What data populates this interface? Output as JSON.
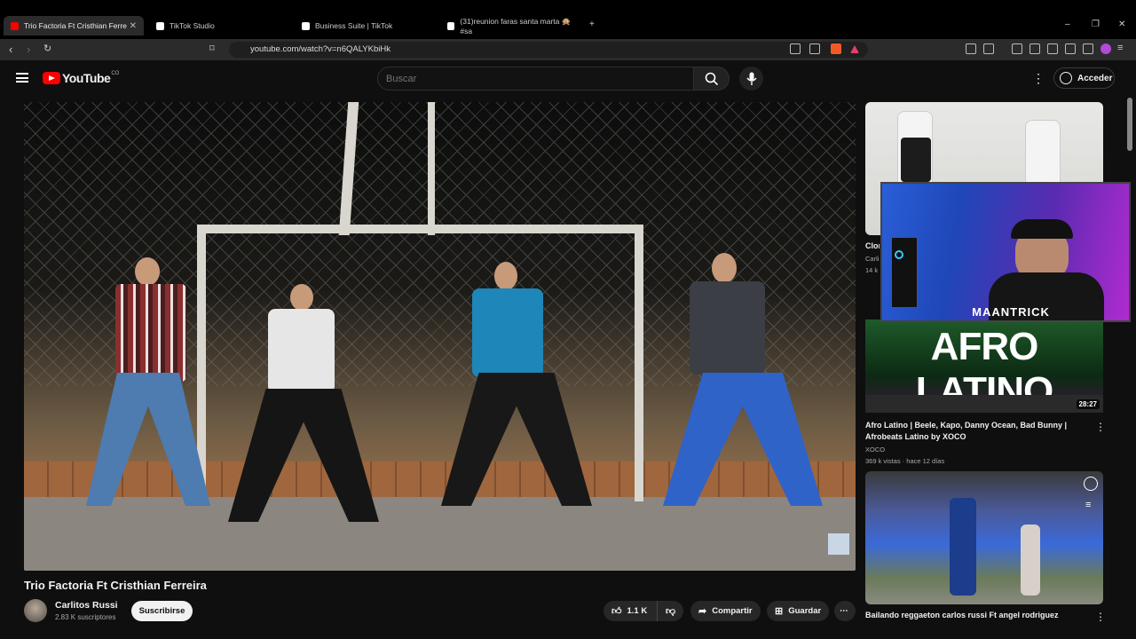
{
  "browser": {
    "tabs": [
      {
        "label": "Trio Factoria Ft Cristhian Ferre"
      },
      {
        "label": "TikTok Studio"
      },
      {
        "label": "Business Suite | TikTok"
      },
      {
        "label": "(31)reunion faras santa marta 🙊#sa"
      }
    ],
    "url": "youtube.com/watch?v=n6QALYKbiHk"
  },
  "youtube": {
    "logo_text": "YouTube",
    "logo_country": "CO",
    "search_placeholder": "Buscar",
    "signin_label": "Acceder"
  },
  "video": {
    "title": "Trio Factoria Ft Cristhian Ferreira",
    "channel": "Carlitos Russi",
    "subscribers": "2.83 K suscriptores",
    "subscribe_label": "Suscribirse",
    "likes": "1.1 K",
    "share_label": "Compartir",
    "save_label": "Guardar"
  },
  "sidebar": {
    "items": [
      {
        "title": "Clon",
        "channel": "Carli",
        "meta": "14 k"
      },
      {
        "thumb_text": "AFRO LATINO",
        "duration": "28:27",
        "title": "Afro Latino | Beele, Kapo, Danny Ocean, Bad Bunny | Afrobeats Latino by XOCO",
        "channel": "XOCO",
        "meta": "369 k vistas · hace 12 días"
      },
      {
        "title": "Bailando reggaeton carlos russi Ft angel rodriguez"
      }
    ]
  },
  "overlay": {
    "name": "MAANTRICK"
  }
}
